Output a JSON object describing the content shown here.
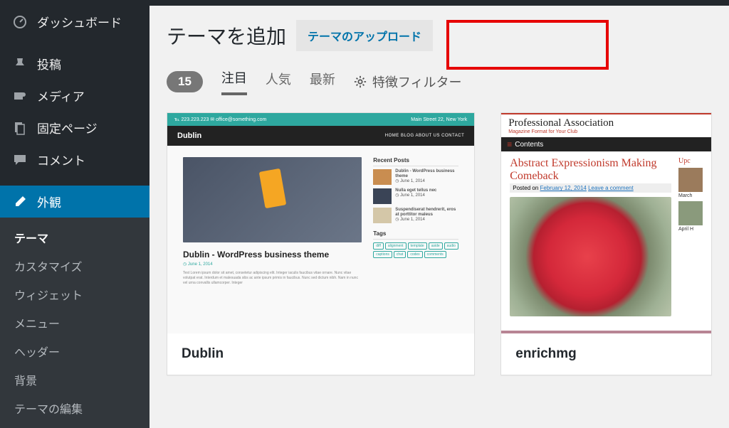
{
  "adminbar": {},
  "sidebar": {
    "items": [
      {
        "icon": "dashboard",
        "label": "ダッシュボード"
      },
      {
        "icon": "pin",
        "label": "投稿"
      },
      {
        "icon": "media",
        "label": "メディア"
      },
      {
        "icon": "pages",
        "label": "固定ページ"
      },
      {
        "icon": "comment",
        "label": "コメント"
      },
      {
        "icon": "brush",
        "label": "外観"
      }
    ],
    "submenu": [
      "テーマ",
      "カスタマイズ",
      "ウィジェット",
      "メニュー",
      "ヘッダー",
      "背景",
      "テーマの編集"
    ]
  },
  "page": {
    "title": "テーマを追加",
    "upload_label": "テーマのアップロード",
    "count": "15",
    "filters": {
      "featured": "注目",
      "popular": "人気",
      "latest": "最新",
      "feature_filter": "特徴フィルター"
    }
  },
  "themes": [
    {
      "name": "Dublin"
    },
    {
      "name": "enrichmg"
    }
  ],
  "preview": {
    "dublin": {
      "topbar_left": "℡ 223.223.223   ✉ office@something.com",
      "topbar_right": "Main Street 22, New York",
      "logo": "Dublin",
      "nav": "HOME   BLOG   ABOUT US   CONTACT",
      "post_title": "Dublin - WordPress business theme",
      "meta": "◷ June 1, 2014",
      "body": "Test Lorem ipsum dolor sit amet, consetetur adipiscing elit. Integer iaculis faucibus vitae ornare. Nunc vitae volutpat erat. Interdum et malesuada sibs ac ante ipsum primis in faucibus. Nunc sed dictum nibh. Nam in nunc vel urna convallis ullamcorper. Integer",
      "recent_label": "Recent Posts",
      "recent": [
        {
          "t": "Dublin - WordPress business theme",
          "d": "◷ June 1, 2014"
        },
        {
          "t": "Nulla eget tellus nec",
          "d": "◷ June 1, 2014"
        },
        {
          "t": "Suspendiserat hendrerit, eros at porttitor maleus",
          "d": "◷ June 1, 2014"
        }
      ],
      "tags_label": "Tags",
      "tags": [
        "diff",
        "alignment",
        "template",
        "aside",
        "audio",
        "captions",
        "chat",
        "codex",
        "comments"
      ]
    },
    "enrichmg": {
      "brand": "Professional Association",
      "sub": "Magazine Format for Your Club",
      "contents": "Contents",
      "headline": "Abstract Expressionism Making Comeback",
      "posted_prefix": "Posted on ",
      "posted_date": "February 12, 2014",
      "posted_comment": "Leave a comment",
      "side_title": "Upc",
      "cap1": "March",
      "cap2": "April H"
    }
  }
}
